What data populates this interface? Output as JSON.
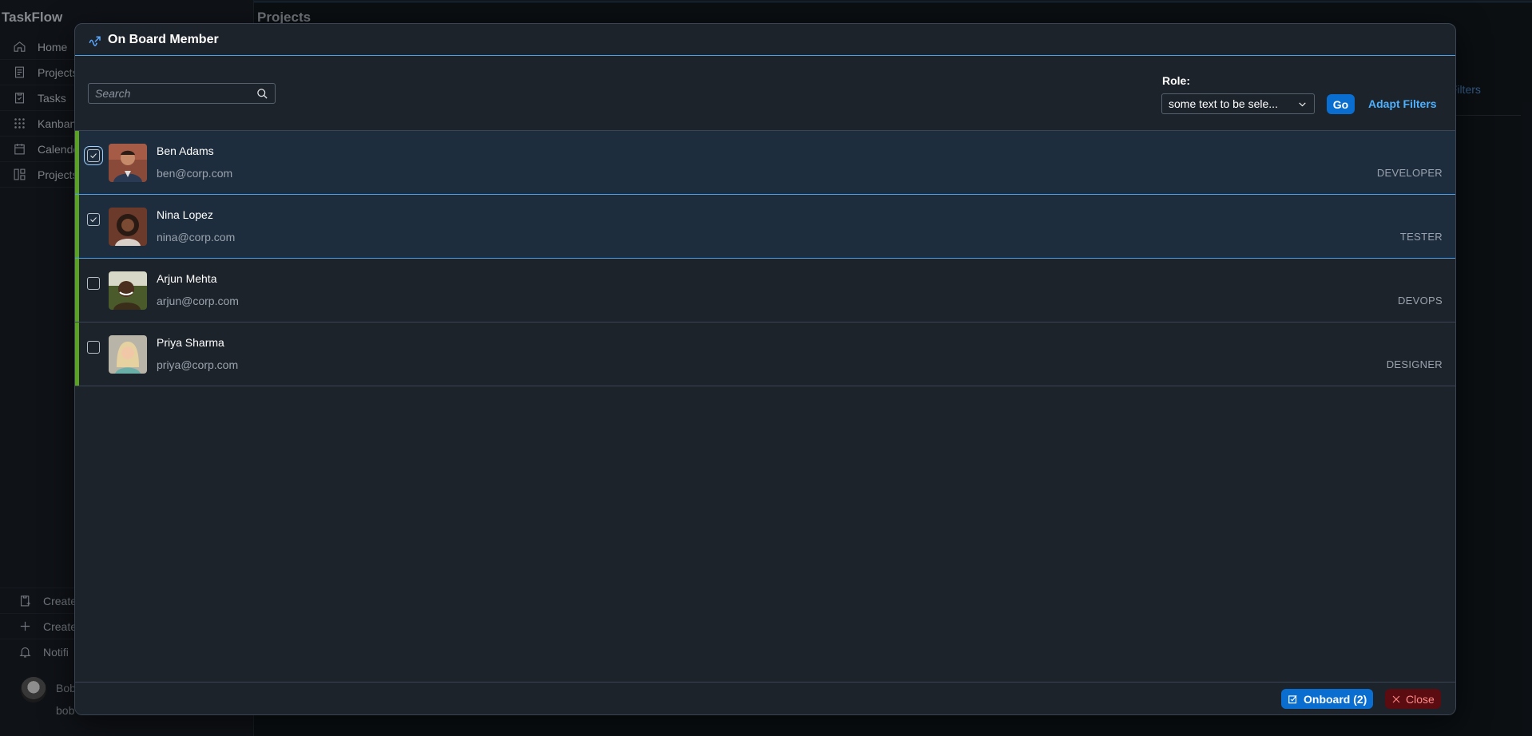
{
  "app": {
    "brand": "TaskFlow",
    "page_title": "Projects",
    "adapt_filters_partial": "t Filters",
    "nav": [
      {
        "label": "Home",
        "icon": "home-icon"
      },
      {
        "label": "Projects",
        "icon": "document-icon"
      },
      {
        "label": "Tasks",
        "icon": "clipboard-check-icon"
      },
      {
        "label": "Kanban",
        "icon": "grid-dots-icon"
      },
      {
        "label": "Calende",
        "icon": "calendar-icon"
      },
      {
        "label": "Projects",
        "icon": "layout-icon"
      }
    ],
    "bottom": [
      {
        "label": "Create",
        "icon": "clipboard-add-icon"
      },
      {
        "label": "Create",
        "icon": "plus-icon"
      },
      {
        "label": "Notifi",
        "icon": "bell-icon"
      }
    ],
    "user": {
      "name": "Bob",
      "email": "bob"
    }
  },
  "dialog": {
    "title": "On Board Member",
    "search_placeholder": "Search",
    "role_label": "Role:",
    "role_value": "some text to be sele...",
    "go_label": "Go",
    "adapt_label": "Adapt Filters",
    "members": [
      {
        "name": "Ben Adams",
        "email": "ben@corp.com",
        "role": "DEVELOPER",
        "selected": true
      },
      {
        "name": "Nina Lopez",
        "email": "nina@corp.com",
        "role": "TESTER",
        "selected": true
      },
      {
        "name": "Arjun Mehta",
        "email": "arjun@corp.com",
        "role": "DEVOPS",
        "selected": false
      },
      {
        "name": "Priya Sharma",
        "email": "priya@corp.com",
        "role": "DESIGNER",
        "selected": false
      }
    ],
    "onboard_label": "Onboard (2)",
    "close_label": "Close"
  },
  "colors": {
    "accent": "#0a6ed1",
    "row_accent": "#5ba123",
    "danger_bg": "#5a0c10"
  }
}
